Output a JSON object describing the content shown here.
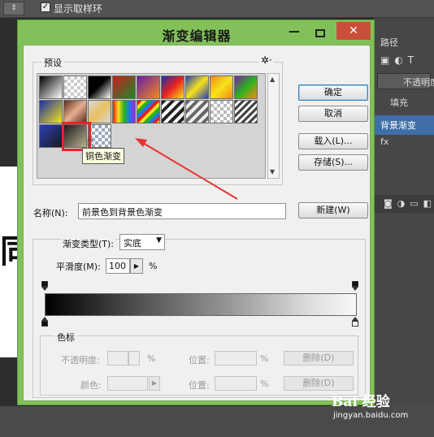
{
  "ps": {
    "show_ring_label": "显示取样环",
    "right_panel": {
      "path_label": "路径",
      "icons": "▣◐T",
      "opacity_label": "不透明度",
      "lock_label": "填充",
      "selected_layer": "背景渐变",
      "second_layer_icon": "fx"
    }
  },
  "dialog": {
    "title": "渐变编辑器",
    "preset_label": "预设",
    "buttons": {
      "ok": "确定",
      "cancel": "取消",
      "load": "载入(L)...",
      "save": "存储(S)...",
      "new": "新建(W)"
    },
    "tooltip": "铜色渐变",
    "name_label": "名称(N):",
    "name_value": "前景色到背景色渐变",
    "gradient_type_label": "渐变类型(T):",
    "gradient_type_value": "实底",
    "smoothness_label": "平滑度(M):",
    "smoothness_value": "100",
    "smoothness_unit": "%",
    "stops": {
      "group_label": "色标",
      "opacity_label": "不透明度:",
      "color_label": "颜色:",
      "location_label": "位置:",
      "delete_label": "删除(D)",
      "percent": "%"
    }
  },
  "watermark": {
    "brand": "Bai 经验",
    "url": "jingyan.baidu.com"
  }
}
